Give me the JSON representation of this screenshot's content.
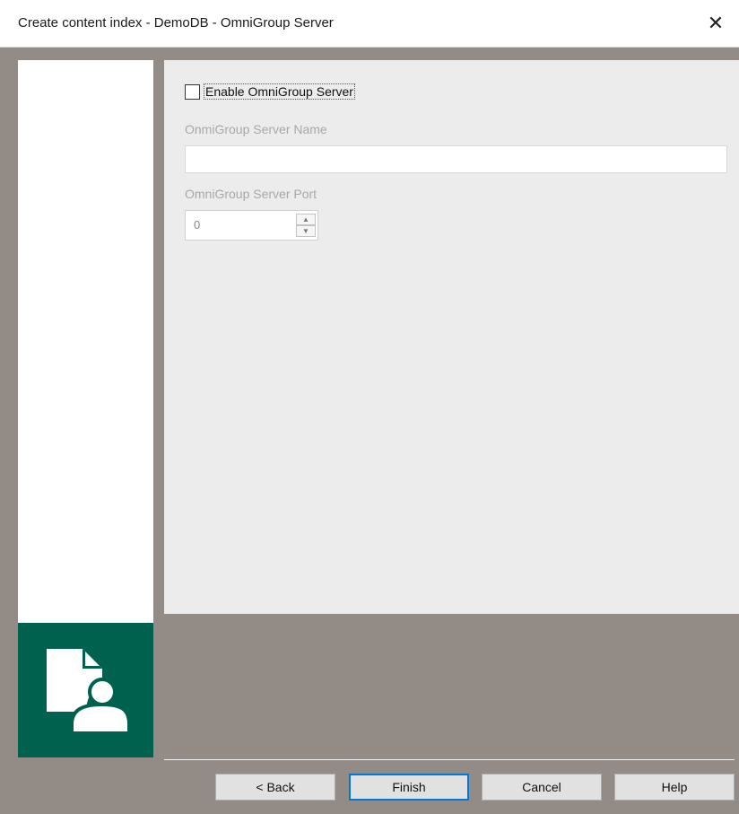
{
  "window": {
    "title": "Create content index - DemoDB - OmniGroup Server"
  },
  "form": {
    "enable_label": "Enable OmniGroup Server",
    "enable_checked": false,
    "server_name_label": "OnmiGroup Server Name",
    "server_name_value": "",
    "server_port_label": "OmniGroup Server Port",
    "server_port_value": "0"
  },
  "buttons": {
    "back": "< Back",
    "finish": "Finish",
    "cancel": "Cancel",
    "help": "Help"
  },
  "icons": {
    "close": "close-icon",
    "wizard": "document-user-icon",
    "spin_up": "spin-up-icon",
    "spin_down": "spin-down-icon"
  },
  "colors": {
    "accent": "#00614f",
    "frame": "#928b86",
    "focus": "#0078d7"
  }
}
